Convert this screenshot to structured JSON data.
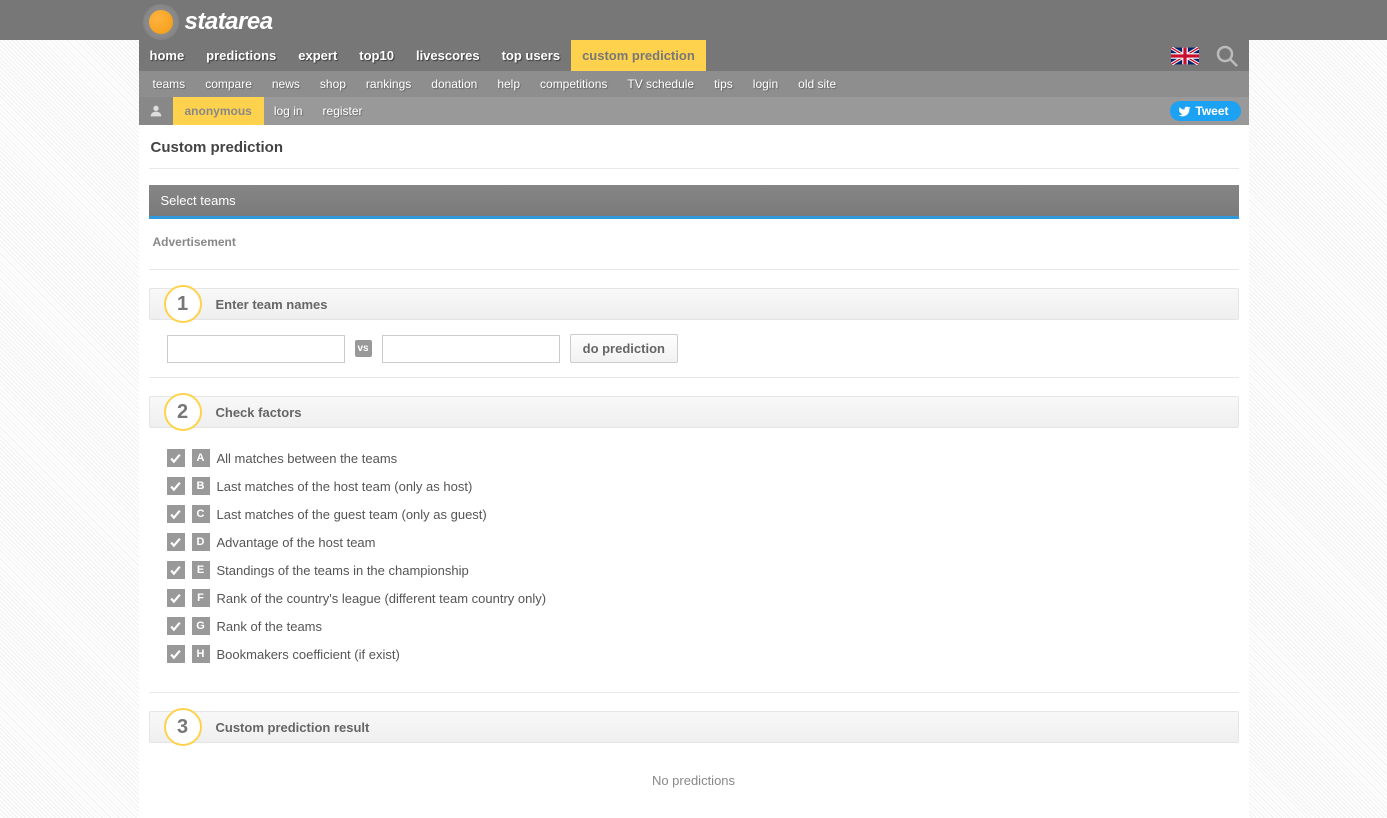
{
  "brand": "statarea",
  "navMain": {
    "items": [
      "home",
      "predictions",
      "expert",
      "top10",
      "livescores",
      "top users",
      "custom prediction"
    ],
    "activeIndex": 6
  },
  "navSub": [
    "teams",
    "compare",
    "news",
    "shop",
    "rankings",
    "donation",
    "help",
    "competitions",
    "TV schedule",
    "tips",
    "login",
    "old site"
  ],
  "user": {
    "status": "anonymous",
    "login_label": "log in",
    "register_label": "register"
  },
  "tweet_label": "Tweet",
  "page_title": "Custom prediction",
  "panel": {
    "select_teams": "Select teams",
    "ad_label": "Advertisement"
  },
  "steps": {
    "one": {
      "num": "1",
      "label": "Enter team names"
    },
    "two": {
      "num": "2",
      "label": "Check factors"
    },
    "three": {
      "num": "3",
      "label": "Custom prediction result"
    }
  },
  "team_form": {
    "vs": "vs",
    "host_value": "",
    "guest_value": "",
    "button": "do prediction"
  },
  "factors": [
    {
      "letter": "A",
      "text": "All matches between the teams",
      "checked": true
    },
    {
      "letter": "B",
      "text": "Last matches of the host team (only as host)",
      "checked": true
    },
    {
      "letter": "C",
      "text": "Last matches of the guest team (only as guest)",
      "checked": true
    },
    {
      "letter": "D",
      "text": "Advantage of the host team",
      "checked": true
    },
    {
      "letter": "E",
      "text": "Standings of the teams in the championship",
      "checked": true
    },
    {
      "letter": "F",
      "text": "Rank of the country's league (different team country only)",
      "checked": true
    },
    {
      "letter": "G",
      "text": "Rank of the teams",
      "checked": true
    },
    {
      "letter": "H",
      "text": "Bookmakers coefficient (if exist)",
      "checked": true
    }
  ],
  "result": {
    "none": "No predictions"
  }
}
